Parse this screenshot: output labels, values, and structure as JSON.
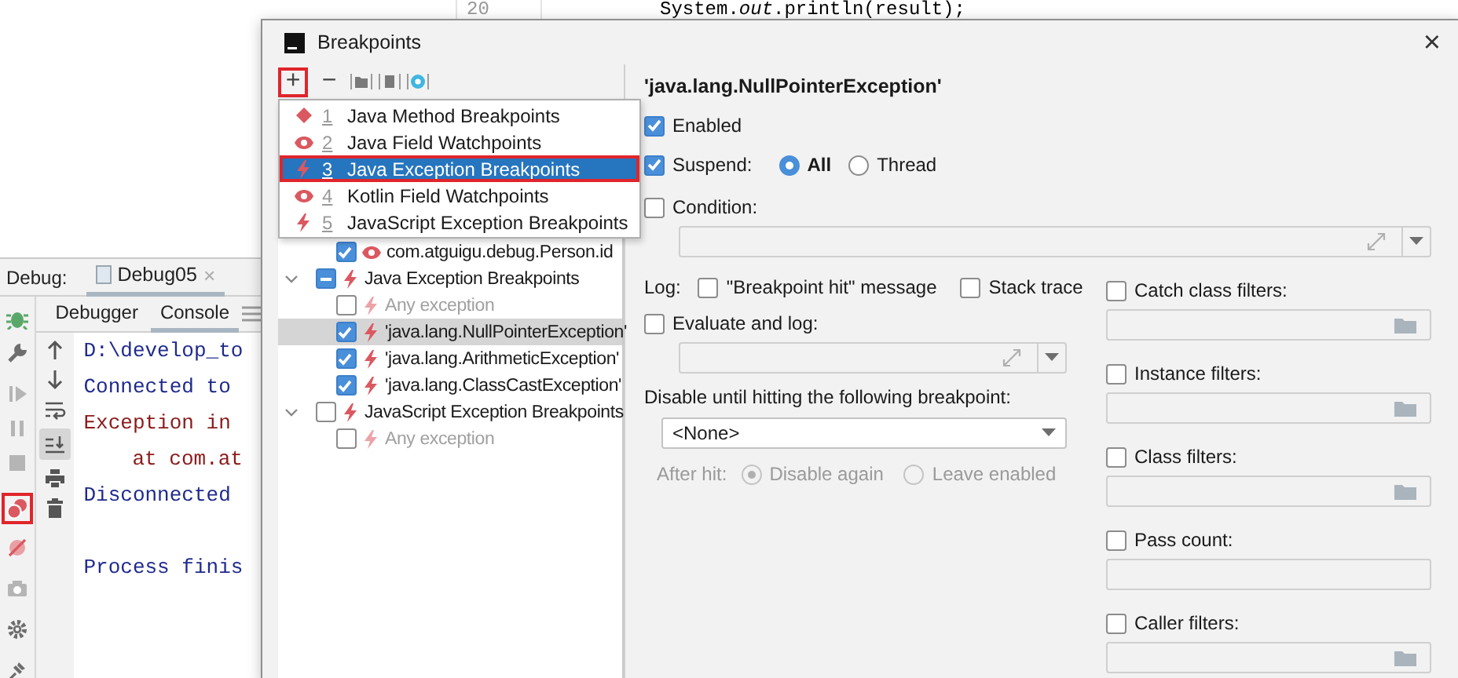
{
  "editor": {
    "line_number": "20",
    "code": "System.*out*.println(result);"
  },
  "debug_panel": {
    "label": "Debug:",
    "session_tab": {
      "label": "Debug05",
      "close": "×"
    },
    "tabs": [
      {
        "label": "Debugger",
        "selected": false
      },
      {
        "label": "Console",
        "selected": true
      }
    ],
    "breakpoints_button_highlighted": true,
    "scroll_to_end_on": true,
    "console_lines": [
      {
        "text": "D:\\develop_to",
        "kind": "out"
      },
      {
        "text": "Connected to",
        "kind": "out"
      },
      {
        "text": "Exception in",
        "kind": "err"
      },
      {
        "text": "at com.at",
        "kind": "trace"
      },
      {
        "text": "Disconnected",
        "kind": "out"
      },
      {
        "text": "Process finis",
        "kind": "out",
        "blank_before": true
      }
    ]
  },
  "dialog": {
    "title": "Breakpoints",
    "close": "×",
    "toolbar": {
      "add": "+",
      "add_highlighted": true,
      "remove": "−"
    },
    "tree": [
      {
        "label": "com.atguigu.debug.Person.id",
        "kind": "field",
        "checked": true,
        "disabled": false,
        "selected": false
      },
      {
        "label": "Java Exception Breakpoints",
        "kind": "exception",
        "partial": true,
        "expanded": true,
        "selected": false,
        "children": [
          {
            "label": "Any exception",
            "kind": "exception",
            "checked": false,
            "disabled": true,
            "selected": false
          },
          {
            "label": "'java.lang.NullPointerException'",
            "kind": "exception",
            "checked": true,
            "disabled": false,
            "selected": true
          },
          {
            "label": "'java.lang.ArithmeticException'",
            "kind": "exception",
            "checked": true,
            "disabled": false,
            "selected": false
          },
          {
            "label": "'java.lang.ClassCastException'",
            "kind": "exception",
            "checked": true,
            "disabled": false,
            "selected": false
          }
        ]
      },
      {
        "label": "JavaScript Exception Breakpoints",
        "kind": "exception",
        "checked": false,
        "partial": false,
        "expanded": true,
        "selected": false,
        "children": [
          {
            "label": "Any exception",
            "kind": "exception",
            "checked": false,
            "disabled": true,
            "selected": false
          }
        ]
      }
    ],
    "add_menu": [
      {
        "number": "1",
        "label": "Java Method Breakpoints",
        "kind": "method",
        "selected": false,
        "highlighted": false
      },
      {
        "number": "2",
        "label": "Java Field Watchpoints",
        "kind": "field",
        "selected": false,
        "highlighted": false
      },
      {
        "number": "3",
        "label": "Java Exception Breakpoints",
        "kind": "exception",
        "selected": true,
        "highlighted": true
      },
      {
        "number": "4",
        "label": "Kotlin Field Watchpoints",
        "kind": "field",
        "selected": false,
        "highlighted": false
      },
      {
        "number": "5",
        "label": "JavaScript Exception Breakpoints",
        "kind": "exception",
        "selected": false,
        "highlighted": false
      }
    ],
    "details": {
      "title": "'java.lang.NullPointerException'",
      "enabled": {
        "label": "Enabled",
        "checked": true
      },
      "suspend": {
        "label": "Suspend:",
        "checked": true,
        "options": [
          {
            "label": "All",
            "selected": true
          },
          {
            "label": "Thread",
            "selected": false
          }
        ]
      },
      "condition": {
        "label": "Condition:",
        "checked": false
      },
      "log": {
        "label": "Log:",
        "options": [
          {
            "label": "\"Breakpoint hit\" message",
            "checked": false
          },
          {
            "label": "Stack trace",
            "checked": false
          }
        ]
      },
      "evaluate_and_log": {
        "label": "Evaluate and log:",
        "checked": false
      },
      "disable_until": {
        "label": "Disable until hitting the following breakpoint:",
        "value": "<None>"
      },
      "after_hit": {
        "label": "After hit:",
        "disabled": true,
        "options": [
          {
            "label": "Disable again",
            "selected": true
          },
          {
            "label": "Leave enabled",
            "selected": false
          }
        ]
      },
      "filters": [
        {
          "label": "Catch class filters:",
          "checked": false,
          "browse": true
        },
        {
          "label": "Instance filters:",
          "checked": false,
          "browse": true
        },
        {
          "label": "Class filters:",
          "checked": false,
          "browse": true
        },
        {
          "label": "Pass count:",
          "checked": false,
          "browse": false
        },
        {
          "label": "Caller filters:",
          "checked": false,
          "browse": true
        }
      ]
    }
  }
}
